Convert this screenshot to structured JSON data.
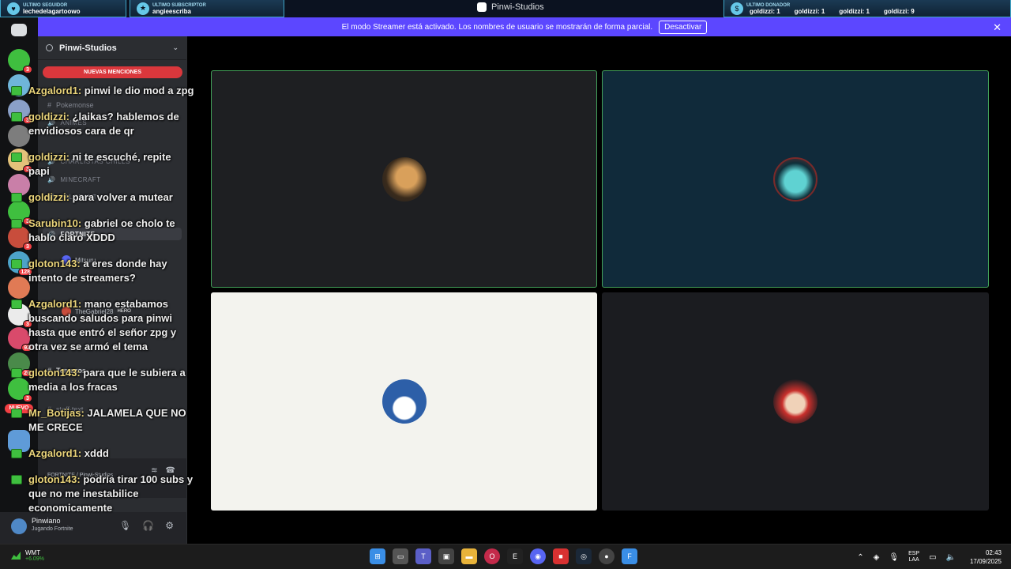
{
  "overlay": {
    "follower_label": "ULTIMO SEGUIDOR",
    "follower_value": "lechedelagartoowo",
    "subscriber_label": "ULTIMO SUBSCRIPTOR",
    "subscriber_value": "angieescriba",
    "donor_label": "ULTIMO DONADOR",
    "donors": [
      "goldizzi: 1",
      "goldizzi: 1",
      "goldizzi: 1",
      "goldizzi: 9"
    ]
  },
  "window": {
    "title": "Pinwi-Studios"
  },
  "banner": {
    "text": "El modo Streamer está activado. Los nombres de usuario se mostrarán de forma parcial.",
    "button": "Desactivar",
    "close": "✕"
  },
  "server": {
    "name": "Pinwi-Studios",
    "chevron": "⌄",
    "mentions": "NUEVAS MENCIONES"
  },
  "rail": {
    "badges": [
      "3",
      "3",
      "3",
      "3",
      "3",
      "128",
      "3",
      "92",
      "26",
      "3"
    ],
    "new_label": "NUEVO"
  },
  "channels": {
    "items": [
      {
        "label": "Pokemonse",
        "icon": "#"
      },
      {
        "label": "ANIMES",
        "icon": "🔊"
      },
      {
        "label": "CHARLISTAS CHILLS",
        "icon": "🔊"
      },
      {
        "label": "MINECRAFT",
        "icon": "🔊"
      },
      {
        "label": "VALORANT",
        "icon": "🔊"
      },
      {
        "label": "FORTNITE",
        "icon": "🔊"
      },
      {
        "label": "Temazos",
        "icon": "#"
      },
      {
        "label": "staff-text",
        "icon": "#"
      }
    ],
    "members": [
      "Mitsuru",
      "TheGabriel28"
    ],
    "hero_badge": "HERO"
  },
  "voice": {
    "sub": "FORTNITE / Pinwi-Studios"
  },
  "user": {
    "name": "Pinwiano",
    "status": "Jugando Fortnite"
  },
  "chat": [
    {
      "user": "Azgalord1:",
      "text": " pinwi le dio mod a zpg"
    },
    {
      "user": "goldizzi:",
      "text": " ¿laikas? hablemos de envidiosos cara de qr"
    },
    {
      "user": "goldizzi:",
      "text": " ni te escuché, repite papi"
    },
    {
      "user": "goldizzi:",
      "text": " para volver a mutear"
    },
    {
      "user": "Sarubin10:",
      "text": " gabriel oe cholo te hablo claro XDDD"
    },
    {
      "user": "gloton143:",
      "text": " a eres donde hay intento de streamers?"
    },
    {
      "user": "Azgalord1:",
      "text": " mano estabamos buscando saludos para pinwi hasta que entró el señor zpg y otra vez se armó el tema"
    },
    {
      "user": "gloton143:",
      "text": " para que le subiera a media a los fracas"
    },
    {
      "user": "Mr_Botijas:",
      "text": " JALAMELA QUE NO ME CRECE"
    },
    {
      "user": "Azgalord1:",
      "text": " xddd"
    },
    {
      "user": "gloton143:",
      "text": " podría tirar 100 subs y que no me inestabilice economicamente"
    }
  ],
  "taskbar": {
    "weather_title": "WMT",
    "weather_change": "+6.09%",
    "lang_top": "ESP",
    "lang_bottom": "LAA",
    "time": "02:43",
    "date": "17/09/2025"
  }
}
